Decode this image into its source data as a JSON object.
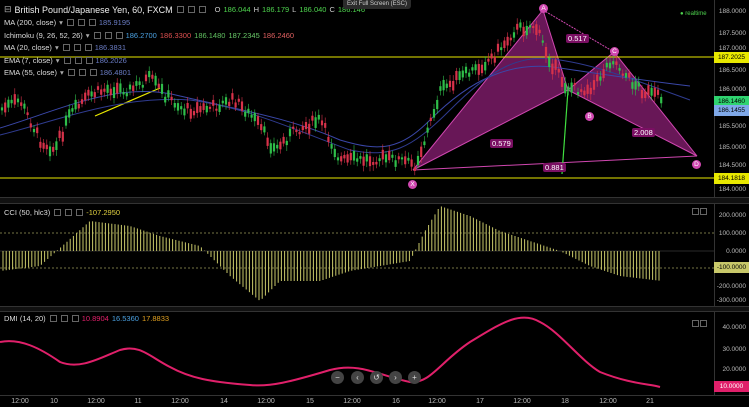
{
  "header": {
    "symbol": "British Pound/Japanese Yen, 60, FXCM",
    "o_label": "O",
    "o_value": "186.044",
    "h_label": "H",
    "h_value": "186.179",
    "l_label": "L",
    "l_value": "186.040",
    "c_label": "C",
    "c_value": "186.146",
    "exit_fullscreen": "Exit Full Screen (ESC)",
    "realtime": "realtime"
  },
  "indicators": [
    {
      "name": "MA (200, close)",
      "values": [
        "185.9195"
      ],
      "colors": [
        "#6a7cc4"
      ]
    },
    {
      "name": "Ichimoku (9, 26, 52, 26)",
      "values": [
        "186.2700",
        "186.3300",
        "186.1480",
        "187.2345",
        "186.2460"
      ],
      "colors": [
        "#4aa0e0",
        "#e05050",
        "#60c060",
        "#6acb6a",
        "#e06060"
      ]
    },
    {
      "name": "MA (20, close)",
      "values": [
        "186.3831"
      ],
      "colors": [
        "#6a7cc4"
      ]
    },
    {
      "name": "EMA (7, close)",
      "values": [
        "186.2026"
      ],
      "colors": [
        "#6a7cc4"
      ]
    },
    {
      "name": "EMA (55, close)",
      "values": [
        "186.4801"
      ],
      "colors": [
        "#6a7cc4"
      ]
    }
  ],
  "price_axis": {
    "ticks": [
      "188.0000",
      "187.5000",
      "187.0000",
      "186.5000",
      "186.0000",
      "185.5000",
      "185.0000",
      "184.5000",
      "184.0000"
    ],
    "tags": [
      {
        "label": "187.2025",
        "color": "#e8e800"
      },
      {
        "label": "186.1460",
        "color": "#2fd36f"
      },
      {
        "label": "186.1455",
        "color": "#7fa8e8"
      },
      {
        "label": "184.1818",
        "color": "#e8e800"
      }
    ]
  },
  "harmonic": {
    "points": [
      "A",
      "B",
      "C",
      "D",
      "X"
    ],
    "ratios": [
      "0.517",
      "0.579",
      "0.881",
      "2.008"
    ]
  },
  "cci": {
    "name": "CCI (50, hlc3)",
    "value": "-107.2950",
    "ticks": [
      "200.0000",
      "100.0000",
      "0.0000",
      "-100.0000",
      "-200.0000",
      "-300.0000"
    ]
  },
  "dmi": {
    "name": "DMI (14, 20)",
    "values": [
      "10.8904",
      "16.5360",
      "17.8833"
    ],
    "colors": [
      "#e0206a",
      "#4aa0e0",
      "#e0a020"
    ],
    "ticks": [
      "40.0000",
      "30.0000",
      "20.0000",
      "10.0000"
    ]
  },
  "time_axis": [
    "12:00",
    "10",
    "12:00",
    "11",
    "12:00",
    "14",
    "12:00",
    "15",
    "12:00",
    "16",
    "12:00",
    "17",
    "12:00",
    "18",
    "12:00",
    "21"
  ],
  "nav": {
    "zoom_out": "−",
    "back": "‹",
    "reset": "↺",
    "forward": "›",
    "zoom_in": "+"
  },
  "colors": {
    "harmonic_fill": "#8b1f74",
    "line_yellow": "#e8e800",
    "dmi_line": "#e0206a",
    "cci_bars": "#c8c86a"
  }
}
